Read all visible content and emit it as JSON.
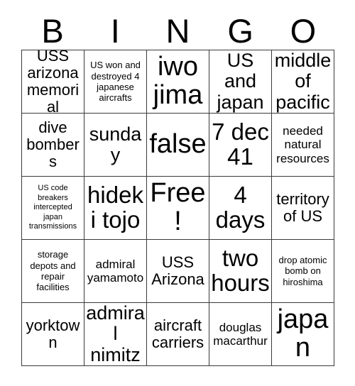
{
  "card": {
    "title": "BINGO",
    "header_letters": [
      "B",
      "I",
      "N",
      "G",
      "O"
    ],
    "free_space_label": "Free!",
    "grid_line_color": "#3a3a3a",
    "text_color": "#000000",
    "background_color": "#ffffff",
    "columns": 5,
    "rows": 5,
    "cells": [
      {
        "text": "USS arizona memorial",
        "size": "md"
      },
      {
        "text": "US won and destroyed 4 japanese aircrafts",
        "size": "xs"
      },
      {
        "text": "iwo jima",
        "size": "xxl"
      },
      {
        "text": "US and japan",
        "size": "lg"
      },
      {
        "text": "middle of pacific",
        "size": "lg"
      },
      {
        "text": "dive bombers",
        "size": "md"
      },
      {
        "text": "sunday",
        "size": "lg"
      },
      {
        "text": "false",
        "size": "xxl"
      },
      {
        "text": "7 dec 41",
        "size": "xl"
      },
      {
        "text": "needed natural resources",
        "size": "sm"
      },
      {
        "text": "US code breakers intercepted japan transmissions",
        "size": "xxs"
      },
      {
        "text": "hideki tojo",
        "size": "xl"
      },
      {
        "text": "Free!",
        "size": "xxl"
      },
      {
        "text": "4 days",
        "size": "xl"
      },
      {
        "text": "territory of US",
        "size": "md"
      },
      {
        "text": "storage depots and repair facilities",
        "size": "xs"
      },
      {
        "text": "admiral yamamoto",
        "size": "sm"
      },
      {
        "text": "USS Arizona",
        "size": "md"
      },
      {
        "text": "two hours",
        "size": "xl"
      },
      {
        "text": "drop atomic bomb on hiroshima",
        "size": "xs"
      },
      {
        "text": "yorktown",
        "size": "md"
      },
      {
        "text": "admiral nimitz",
        "size": "lg"
      },
      {
        "text": "aircraft carriers",
        "size": "md"
      },
      {
        "text": "douglas macarthur",
        "size": "sm"
      },
      {
        "text": "japan",
        "size": "xxl"
      }
    ]
  }
}
